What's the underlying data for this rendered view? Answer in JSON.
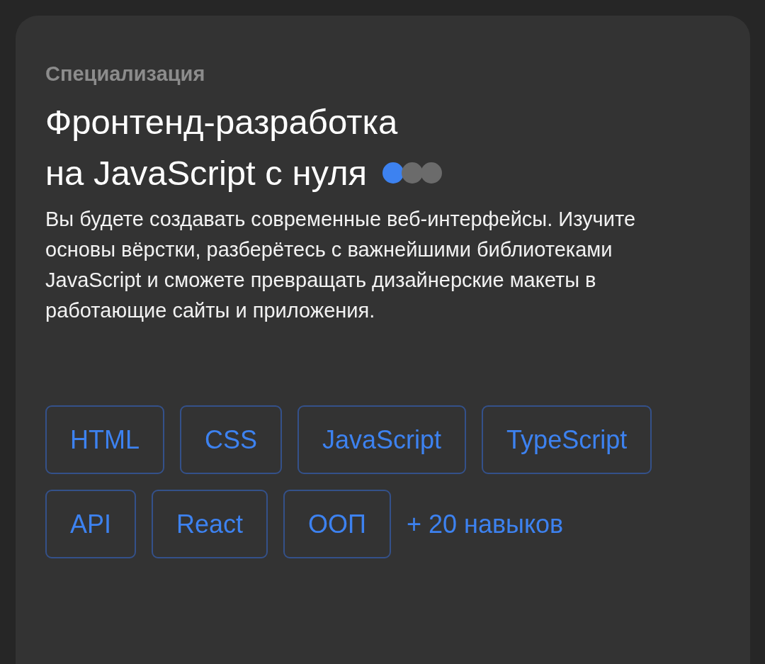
{
  "card": {
    "eyebrow": "Специализация",
    "title_lines": [
      "Фронтенд-разработка",
      "на JavaScript с нуля"
    ],
    "difficulty_dots": [
      {
        "filled": true
      },
      {
        "filled": false
      },
      {
        "filled": false
      }
    ],
    "description": "Вы будете создавать современные веб-интерфейсы. Изучите основы вёрстки, разберётесь с важнейшими библиотеками JavaScript и сможете превращать дизайнерские макеты в работающие сайты и приложения.",
    "skills": [
      "HTML",
      "CSS",
      "JavaScript",
      "TypeScript",
      "API",
      "React",
      "ООП"
    ],
    "more_skills": "+ 20 навыков"
  }
}
